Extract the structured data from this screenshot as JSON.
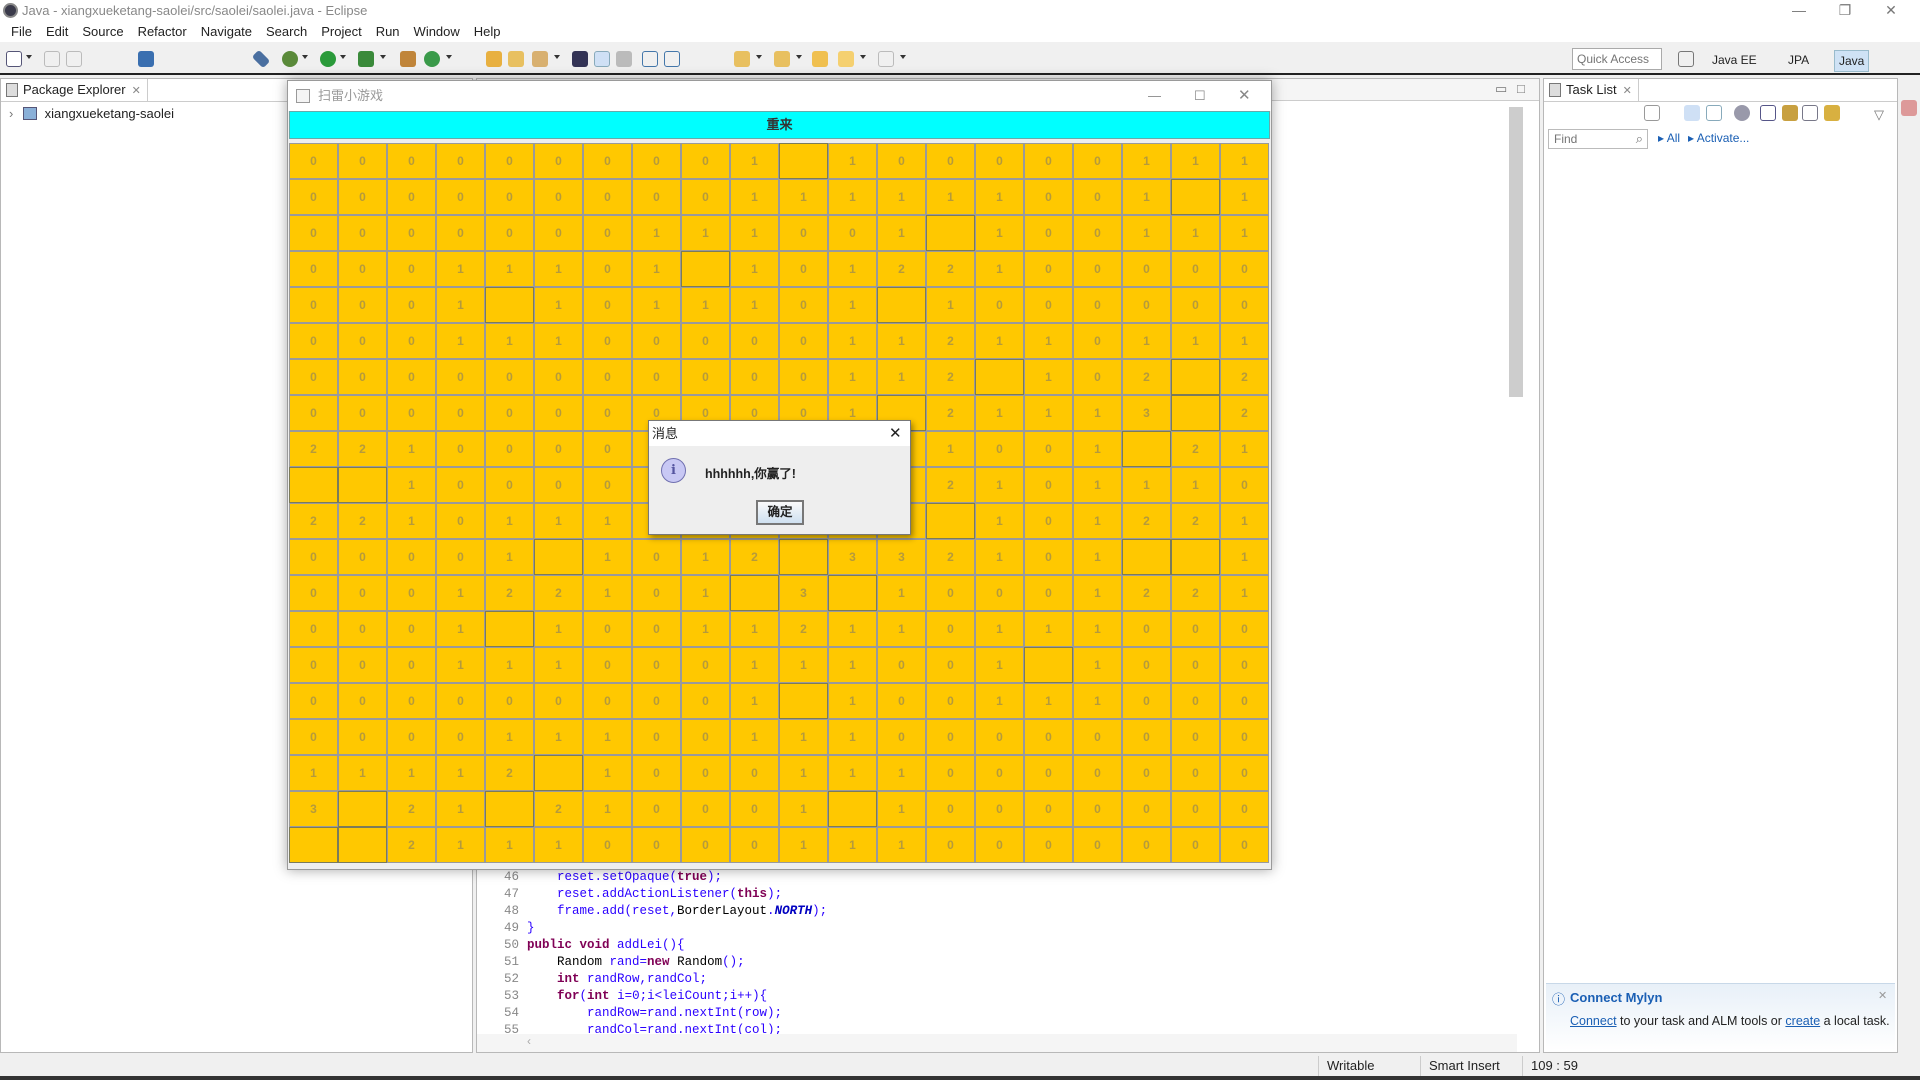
{
  "window": {
    "title": "Java - xiangxueketang-saolei/src/saolei/saolei.java - Eclipse",
    "minimize": "—",
    "restore": "❐",
    "close": "✕"
  },
  "menu": [
    "File",
    "Edit",
    "Source",
    "Refactor",
    "Navigate",
    "Search",
    "Project",
    "Run",
    "Window",
    "Help"
  ],
  "toolbar": {
    "quick_access_placeholder": "Quick Access",
    "perspectives": [
      "Java EE",
      "JPA",
      "Java"
    ],
    "active_perspective": "Java"
  },
  "package_explorer": {
    "tab": "Package Explorer",
    "items": [
      {
        "label": "xiangxueketang-saolei",
        "icon": "java-project-icon"
      }
    ]
  },
  "editor": {
    "lines": [
      {
        "n": "46",
        "text": "    reset.setOpaque(true);"
      },
      {
        "n": "47",
        "text": "    reset.addActionListener(this);"
      },
      {
        "n": "48",
        "text": "    frame.add(reset,BorderLayout.NORTH);"
      },
      {
        "n": "49",
        "text": "}"
      },
      {
        "n": "50",
        "text": "public void addLei(){"
      },
      {
        "n": "51",
        "text": "    Random rand=new Random();"
      },
      {
        "n": "52",
        "text": "    int randRow,randCol;"
      },
      {
        "n": "53",
        "text": "    for(int i=0;i<leiCount;i++){"
      },
      {
        "n": "54",
        "text": "        randRow=rand.nextInt(row);"
      },
      {
        "n": "55",
        "text": "        randCol=rand.nextInt(col);"
      }
    ]
  },
  "task_list": {
    "tab": "Task List",
    "find_placeholder": "Find",
    "all_link": "All",
    "activate_link": "Activate...",
    "mylyn": {
      "title": "Connect Mylyn",
      "connect": "Connect",
      "middle": " to your task and ALM tools or ",
      "create": "create",
      "end": " a local task."
    }
  },
  "status": {
    "writable": "Writable",
    "insert_mode": "Smart Insert",
    "position": "109 : 59"
  },
  "game": {
    "title": "扫雷小游戏",
    "reset_label": "重来",
    "colors": {
      "reset_bg": "#00ffff",
      "cell_bg": "#ffc800"
    },
    "grid": [
      [
        "0",
        "0",
        "0",
        "0",
        "0",
        "0",
        "0",
        "0",
        "0",
        "1",
        "",
        "1",
        "0",
        "0",
        "0",
        "0",
        "0",
        "1",
        "1",
        "1"
      ],
      [
        "0",
        "0",
        "0",
        "0",
        "0",
        "0",
        "0",
        "0",
        "0",
        "1",
        "1",
        "1",
        "1",
        "1",
        "1",
        "0",
        "0",
        "1",
        "",
        "1"
      ],
      [
        "0",
        "0",
        "0",
        "0",
        "0",
        "0",
        "0",
        "1",
        "1",
        "1",
        "0",
        "0",
        "1",
        "",
        "1",
        "0",
        "0",
        "1",
        "1",
        "1"
      ],
      [
        "0",
        "0",
        "0",
        "1",
        "1",
        "1",
        "0",
        "1",
        "",
        "1",
        "0",
        "1",
        "2",
        "2",
        "1",
        "0",
        "0",
        "0",
        "0",
        "0"
      ],
      [
        "0",
        "0",
        "0",
        "1",
        "",
        "1",
        "0",
        "1",
        "1",
        "1",
        "0",
        "1",
        "",
        "1",
        "0",
        "0",
        "0",
        "0",
        "0",
        "0"
      ],
      [
        "0",
        "0",
        "0",
        "1",
        "1",
        "1",
        "0",
        "0",
        "0",
        "0",
        "0",
        "1",
        "1",
        "2",
        "1",
        "1",
        "0",
        "1",
        "1",
        "1"
      ],
      [
        "0",
        "0",
        "0",
        "0",
        "0",
        "0",
        "0",
        "0",
        "0",
        "0",
        "0",
        "1",
        "1",
        "2",
        "",
        "1",
        "0",
        "2",
        "",
        "2"
      ],
      [
        "0",
        "0",
        "0",
        "0",
        "0",
        "0",
        "0",
        "0",
        "0",
        "0",
        "0",
        "1",
        "",
        "2",
        "1",
        "1",
        "1",
        "3",
        "",
        "2"
      ],
      [
        "2",
        "2",
        "1",
        "0",
        "0",
        "0",
        "0",
        null,
        null,
        null,
        null,
        null,
        null,
        "1",
        "0",
        "0",
        "1",
        "",
        "2",
        "1"
      ],
      [
        "",
        "",
        "1",
        "0",
        "0",
        "0",
        "0",
        null,
        null,
        null,
        null,
        null,
        null,
        "2",
        "1",
        "0",
        "1",
        "1",
        "1",
        "0"
      ],
      [
        "2",
        "2",
        "1",
        "0",
        "1",
        "1",
        "1",
        null,
        null,
        null,
        null,
        null,
        null,
        "",
        "1",
        "0",
        "1",
        "2",
        "2",
        "1"
      ],
      [
        "0",
        "0",
        "0",
        "0",
        "1",
        "",
        "1",
        "0",
        "1",
        "2",
        "",
        "3",
        "3",
        "2",
        "1",
        "0",
        "1",
        "",
        "",
        "1"
      ],
      [
        "0",
        "0",
        "0",
        "1",
        "2",
        "2",
        "1",
        "0",
        "1",
        "",
        "3",
        "",
        "1",
        "0",
        "0",
        "0",
        "1",
        "2",
        "2",
        "1"
      ],
      [
        "0",
        "0",
        "0",
        "1",
        "",
        "1",
        "0",
        "0",
        "1",
        "1",
        "2",
        "1",
        "1",
        "0",
        "1",
        "1",
        "1",
        "0",
        "0",
        "0"
      ],
      [
        "0",
        "0",
        "0",
        "1",
        "1",
        "1",
        "0",
        "0",
        "0",
        "1",
        "1",
        "1",
        "0",
        "0",
        "1",
        "",
        "1",
        "0",
        "0",
        "0"
      ],
      [
        "0",
        "0",
        "0",
        "0",
        "0",
        "0",
        "0",
        "0",
        "0",
        "1",
        "",
        "1",
        "0",
        "0",
        "1",
        "1",
        "1",
        "0",
        "0",
        "0"
      ],
      [
        "0",
        "0",
        "0",
        "0",
        "1",
        "1",
        "1",
        "0",
        "0",
        "1",
        "1",
        "1",
        "0",
        "0",
        "0",
        "0",
        "0",
        "0",
        "0",
        "0"
      ],
      [
        "1",
        "1",
        "1",
        "1",
        "2",
        "",
        "1",
        "0",
        "0",
        "0",
        "1",
        "1",
        "1",
        "0",
        "0",
        "0",
        "0",
        "0",
        "0",
        "0"
      ],
      [
        "3",
        "",
        "2",
        "1",
        "",
        "2",
        "1",
        "0",
        "0",
        "0",
        "1",
        "",
        "1",
        "0",
        "0",
        "0",
        "0",
        "0",
        "0",
        "0"
      ],
      [
        "",
        "",
        "2",
        "1",
        "1",
        "1",
        "0",
        "0",
        "0",
        "0",
        "1",
        "1",
        "1",
        "0",
        "0",
        "0",
        "0",
        "0",
        "0",
        "0"
      ]
    ],
    "dialog": {
      "title": "消息",
      "message": "hhhhhh,你赢了!",
      "ok_label": "确定",
      "icon": "info-icon"
    }
  }
}
